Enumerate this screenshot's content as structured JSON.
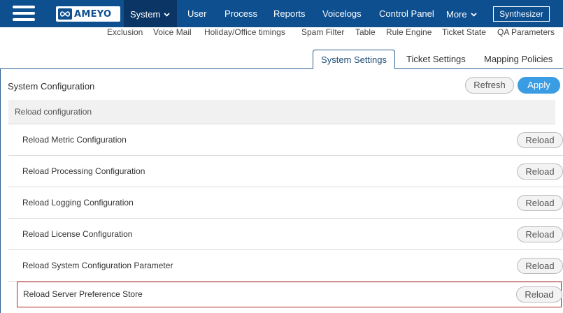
{
  "brand": {
    "logo_text": "AMEYO"
  },
  "nav": {
    "system": "System",
    "user": "User",
    "process": "Process",
    "reports": "Reports",
    "voicelogs": "Voicelogs",
    "control_panel": "Control Panel",
    "more": "More",
    "synthesizer": "Synthesizer"
  },
  "sublinks": [
    "Exclusion",
    "Voice Mail",
    "Holiday/Office timings",
    "Spam Filter",
    "Table",
    "Rule Engine",
    "Ticket State",
    "QA Parameters"
  ],
  "tabs": {
    "system_settings": "System Settings",
    "ticket_settings": "Ticket Settings",
    "mapping_policies": "Mapping Policies"
  },
  "section": {
    "title": "System Configuration",
    "refresh_label": "Refresh",
    "apply_label": "Apply",
    "group_title": "Reload configuration",
    "reload_label": "Reload",
    "rows": [
      "Reload Metric Configuration",
      "Reload Processing Configuration",
      "Reload Logging Configuration",
      "Reload License Configuration",
      "Reload System Configuration Parameter",
      "Reload Server Preference Store"
    ]
  },
  "colors": {
    "nav_bg": "#0d4f8f",
    "nav_active": "#0a3564",
    "apply": "#3a9de3",
    "selected_border": "#b22222"
  }
}
